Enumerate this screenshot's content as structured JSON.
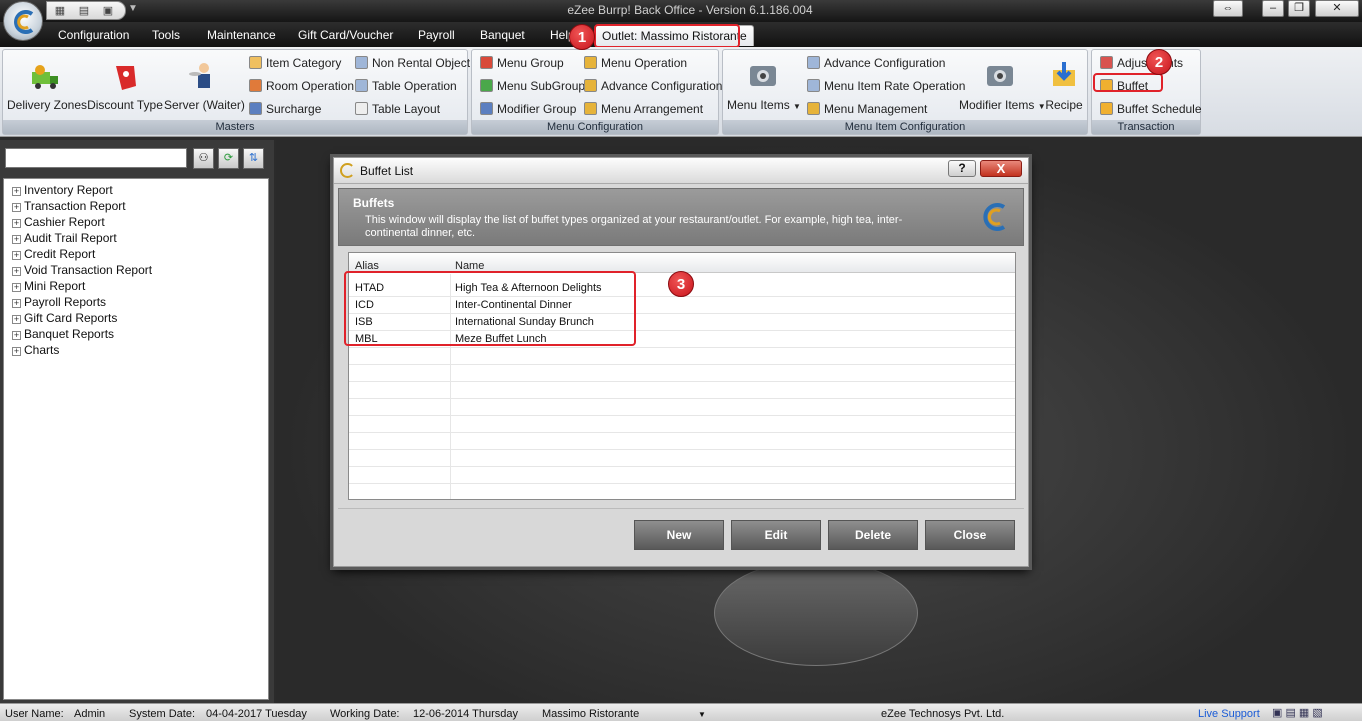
{
  "window": {
    "title": "eZee Burrp! Back Office - Version 6.1.186.004"
  },
  "menu": {
    "items": [
      "Configuration",
      "Tools",
      "Maintenance",
      "Gift Card/Voucher",
      "Payroll",
      "Banquet",
      "Help"
    ],
    "active": "Outlet: Massimo Ristorante"
  },
  "ribbon": {
    "masters": {
      "title": "Masters",
      "big": [
        "Delivery Zones",
        "Discount Type",
        "Server (Waiter)"
      ],
      "col1": [
        "Item Category",
        "Room Operation",
        "Surcharge"
      ],
      "col2": [
        "Non Rental Object",
        "Table Operation",
        "Table Layout"
      ]
    },
    "menu_config": {
      "title": "Menu Configuration",
      "col1": [
        "Menu Group",
        "Menu SubGroup",
        "Modifier Group"
      ],
      "col2": [
        "Menu Operation",
        "Advance Configuration",
        "Menu Arrangement"
      ]
    },
    "menu_item_config": {
      "title": "Menu Item Configuration",
      "menu_items": "Menu Items",
      "col": [
        "Advance Configuration",
        "Menu Item Rate Operation",
        "Menu Management"
      ],
      "modifier_items": "Modifier Items",
      "recipe": "Recipe"
    },
    "transaction": {
      "title": "Transaction",
      "items": [
        "Adjustments",
        "Buffet",
        "Buffet Schedule"
      ]
    }
  },
  "tree": {
    "items": [
      "Inventory Report",
      "Transaction Report",
      "Cashier Report",
      "Audit Trail Report",
      "Credit Report",
      "Void Transaction Report",
      "Mini Report",
      "Payroll Reports",
      "Gift Card Reports",
      "Banquet Reports",
      "Charts"
    ]
  },
  "dialog": {
    "title": "Buffet List",
    "header_title": "Buffets",
    "description": "This window will display the list of buffet types organized at your restaurant/outlet. For example, high tea, inter-continental dinner, etc.",
    "columns": [
      "Alias",
      "Name"
    ],
    "rows": [
      {
        "alias": "HTAD",
        "name": "High Tea & Afternoon Delights"
      },
      {
        "alias": "ICD",
        "name": "Inter-Continental Dinner"
      },
      {
        "alias": "ISB",
        "name": "International Sunday Brunch"
      },
      {
        "alias": "MBL",
        "name": "Meze Buffet Lunch"
      }
    ],
    "buttons": {
      "new": "New",
      "edit": "Edit",
      "delete": "Delete",
      "close": "Close"
    },
    "help": "?",
    "close_x": "X"
  },
  "annotations": [
    "1",
    "2",
    "3"
  ],
  "status": {
    "user_label": "User Name:",
    "user": "Admin",
    "sysdate_label": "System Date:",
    "sysdate": "04-04-2017 Tuesday",
    "workdate_label": "Working Date:",
    "workdate": "12-06-2014 Thursday",
    "outlet": "Massimo Ristorante",
    "company": "eZee Technosys Pvt. Ltd.",
    "support": "Live Support"
  },
  "colors": {
    "accent_red": "#e0222a",
    "menubar": "#1a1a1a",
    "dialog_button": "#6e6e6e"
  }
}
